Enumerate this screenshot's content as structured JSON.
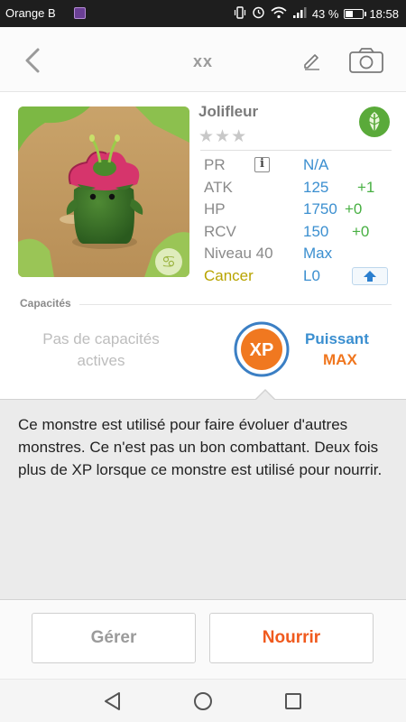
{
  "status_bar": {
    "carrier": "Orange B",
    "battery": "43 %",
    "battery_level": 0.43,
    "time": "18:58",
    "icons": [
      "vibrate-icon",
      "alarm-icon",
      "wifi-icon",
      "signal-icon",
      "battery-icon"
    ]
  },
  "header": {
    "title": "xx",
    "icons": [
      "back-chevron-icon",
      "pencil-icon",
      "camera-icon"
    ]
  },
  "monster": {
    "name": "Jolifleur",
    "stars": "★★★",
    "element_icon": "leaf-icon",
    "sign_icon": "cancer-zodiac-icon",
    "stats": {
      "pr": {
        "label": "PR",
        "value": "N/A"
      },
      "atk": {
        "label": "ATK",
        "value": "125",
        "bonus": "+1"
      },
      "hp": {
        "label": "HP",
        "value": "1750",
        "bonus": "+0"
      },
      "rcv": {
        "label": "RCV",
        "value": "150",
        "bonus": "+0"
      },
      "level": {
        "label": "Niveau 40",
        "value": "Max"
      },
      "sign": {
        "label": "Cancer",
        "value": "L0"
      }
    }
  },
  "capacities": {
    "title": "Capacités",
    "none_text": "Pas de capacités actives",
    "badge_text": "XP",
    "passive_name": "Puissant",
    "passive_level": "MAX"
  },
  "description": "Ce monstre est utilisé pour faire évoluer d'autres monstres. Ce n'est pas un bon combattant. Deux fois plus de XP lorsque ce monstre est utilisé pour nourrir.",
  "actions": {
    "manage": "Gérer",
    "feed": "Nourrir"
  },
  "colors": {
    "accent_blue": "#3b8fd0",
    "accent_orange": "#f05a1e",
    "bonus_green": "#48b043",
    "sign_yellow": "#b8a400"
  }
}
